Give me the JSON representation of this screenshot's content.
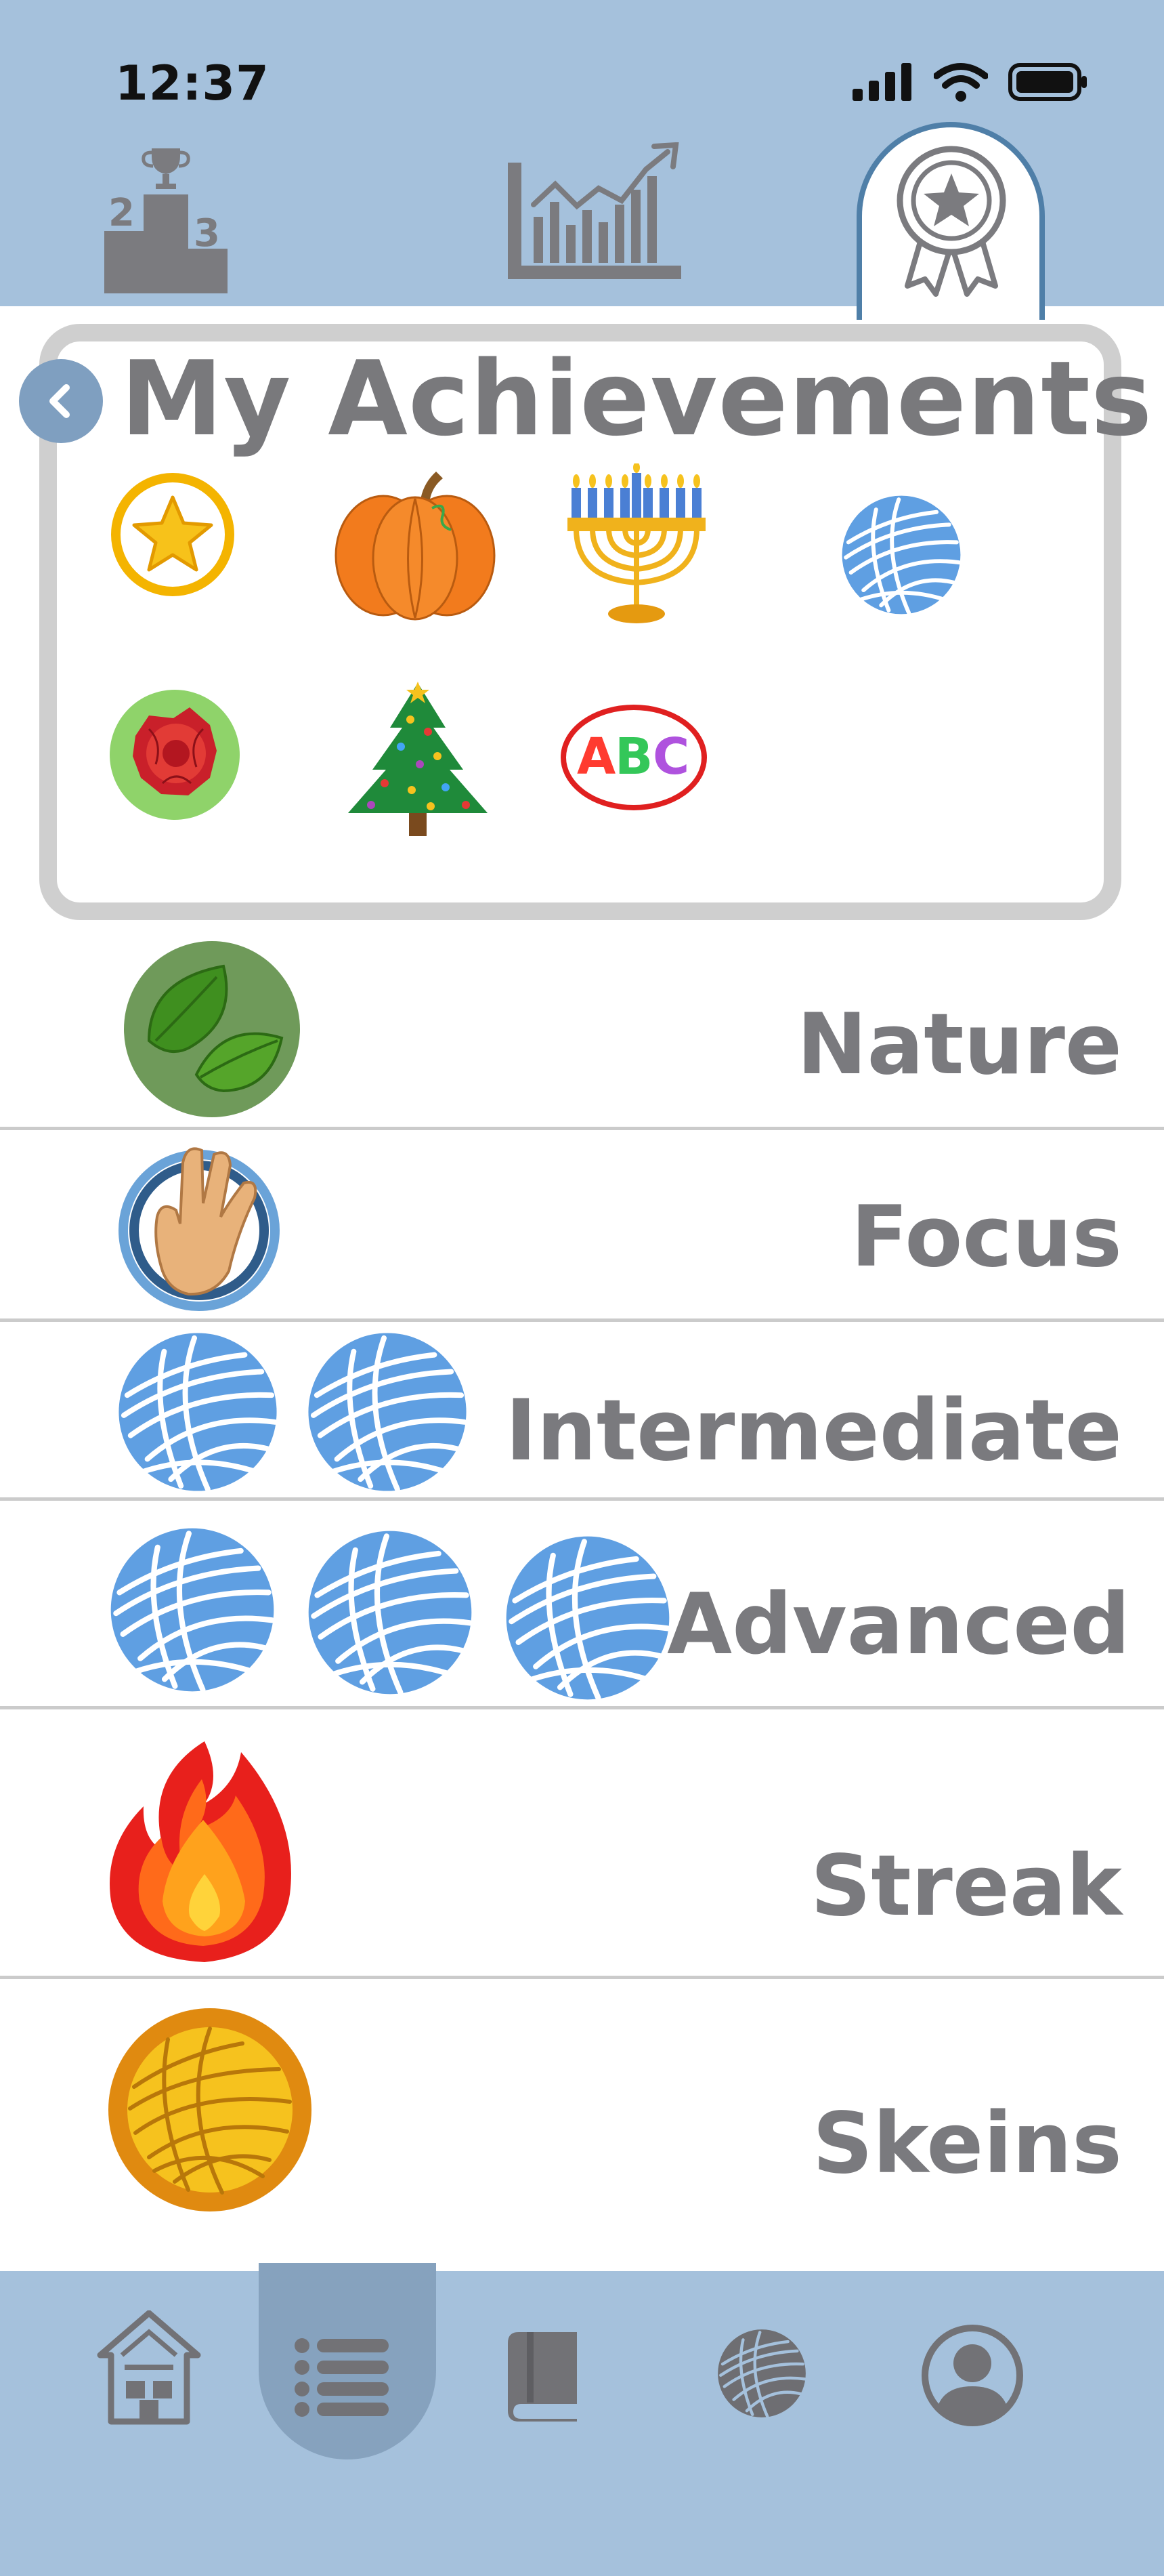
{
  "status_bar": {
    "time": "12:37"
  },
  "top_tabs": [
    {
      "name": "leaderboard",
      "icon": "podium-icon"
    },
    {
      "name": "statistics",
      "icon": "bar-chart-icon"
    },
    {
      "name": "achievements",
      "icon": "award-ribbon-icon",
      "active": true
    }
  ],
  "page": {
    "title": "My Achievements",
    "back_icon": "chevron-left-icon"
  },
  "earned_badges": [
    {
      "icon": "gold-star-badge-icon"
    },
    {
      "icon": "pumpkin-badge-icon"
    },
    {
      "icon": "menorah-badge-icon"
    },
    {
      "icon": "yarn-ball-badge-icon"
    },
    {
      "icon": "red-flower-badge-icon"
    },
    {
      "icon": "christmas-tree-badge-icon"
    },
    {
      "icon": "abc-badge-icon"
    }
  ],
  "categories": [
    {
      "label": "Nature",
      "badge_icon": "leaves-badge-icon",
      "badge_count": 1
    },
    {
      "label": "Focus",
      "badge_icon": "hand-sign-badge-icon",
      "badge_count": 1
    },
    {
      "label": "Intermediate",
      "badge_icon": "yarn-ball-badge-icon",
      "badge_count": 2
    },
    {
      "label": "Advanced",
      "badge_icon": "yarn-ball-badge-icon",
      "badge_count": 3
    },
    {
      "label": "Streak",
      "badge_icon": "flame-badge-icon",
      "badge_count": 1
    },
    {
      "label": "Skeins",
      "badge_icon": "gold-yarn-badge-icon",
      "badge_count": 1
    }
  ],
  "bottom_nav": [
    {
      "name": "home",
      "icon": "house-icon"
    },
    {
      "name": "list",
      "icon": "list-icon",
      "active": true
    },
    {
      "name": "book",
      "icon": "book-icon"
    },
    {
      "name": "yarn",
      "icon": "yarn-ball-icon"
    },
    {
      "name": "profile",
      "icon": "user-avatar-icon"
    }
  ],
  "colors": {
    "header_bg": "#a5c1dc",
    "active_tab_border": "#4f7fa8",
    "nav_active_bg": "#86a2be",
    "card_border": "#cfcfcf",
    "text_gray": "#7a7a7e",
    "yarn_blue": "#5b9be0"
  }
}
